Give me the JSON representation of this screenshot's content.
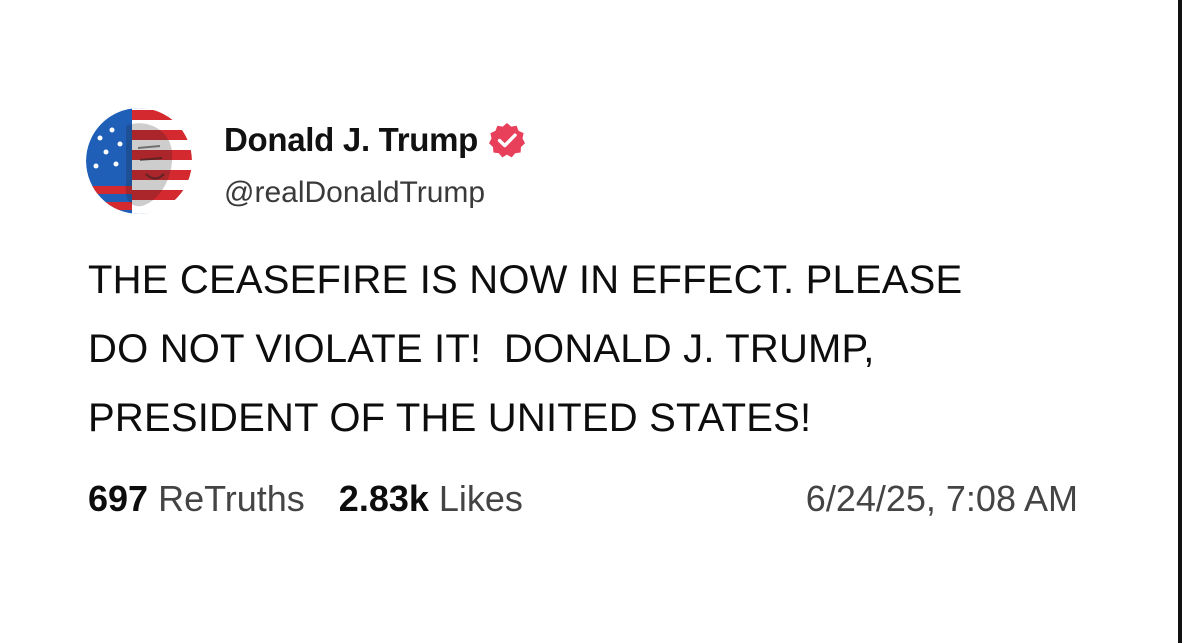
{
  "post": {
    "author": {
      "display_name": "Donald J. Trump",
      "handle": "@realDonaldTrump",
      "verified": true,
      "verified_icon": "verified-badge-icon",
      "verified_color": "#e83f5b"
    },
    "body": "THE CEASEFIRE IS NOW IN EFFECT. PLEASE\nDO NOT VIOLATE IT!  DONALD J. TRUMP,\nPRESIDENT OF THE UNITED STATES!",
    "stats": {
      "retruths_count": "697",
      "retruths_label": "ReTruths",
      "likes_count": "2.83k",
      "likes_label": "Likes"
    },
    "timestamp": "6/24/25, 7:08 AM"
  },
  "colors": {
    "background": "#ffffff",
    "text": "#0d0d0d",
    "muted_text": "#444444",
    "badge": "#e83f5b"
  }
}
